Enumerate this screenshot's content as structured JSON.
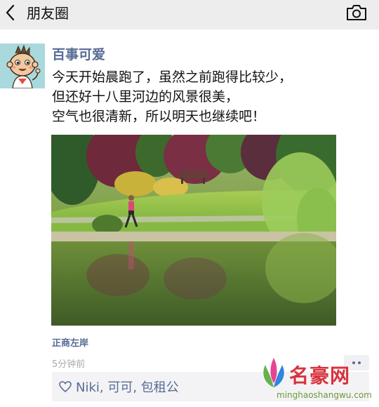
{
  "header": {
    "title": "朋友圈",
    "back_icon": "chevron-left-icon",
    "camera_icon": "camera-icon"
  },
  "post": {
    "author": "百事可爱",
    "text": "今天开始晨跑了，虽然之前跑得比较少，\n但还好十八里河边的风景很美，\n空气也很清新，所以明天也继续吧！",
    "location": "正商左岸",
    "time": "5分钟前",
    "likes": "Niki, 可可, 包租公"
  },
  "watermark": {
    "brand": "名豪网",
    "url": "minghaoshangwu.com"
  },
  "colors": {
    "link": "#576b95",
    "topbar_bg": "#ededed",
    "avatar_bg": "#a9d8dd"
  }
}
